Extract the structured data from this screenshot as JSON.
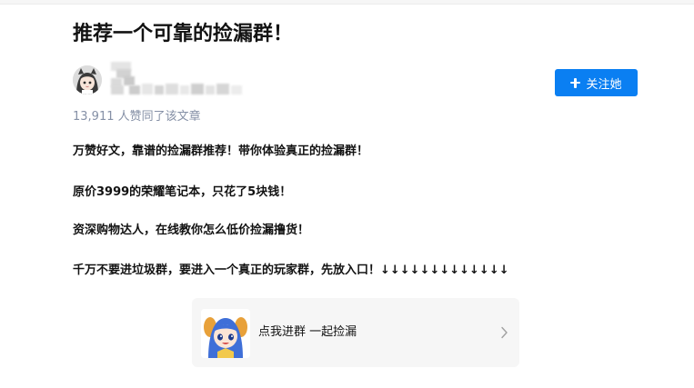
{
  "article": {
    "title": "推荐一个可靠的捡漏群！",
    "upvote_text": "13,911 人赞同了该文章",
    "paragraphs": [
      "万赞好文，靠谱的捡漏群推荐！带你体验真正的捡漏群！",
      "原价3999的荣耀笔记本，只花了5块钱！",
      "资深购物达人，在线教你怎么低价捡漏撸货！",
      "千万不要进垃圾群，要进入一个真正的玩家群，先放入口！↓↓↓↓↓↓↓↓↓↓↓↓↓"
    ]
  },
  "author": {
    "follow_label": "关注她",
    "avatar_icon": "anime-girl-avatar",
    "name_obscured": true
  },
  "card": {
    "label": "点我进群 一起捡漏",
    "thumb_icon": "anime-character-thumbnail",
    "chevron_icon": "chevron-right-icon"
  },
  "colors": {
    "accent": "#0a7ff2",
    "text_primary": "#121212",
    "text_secondary": "#8590a6",
    "card_bg": "#f6f6f6"
  }
}
